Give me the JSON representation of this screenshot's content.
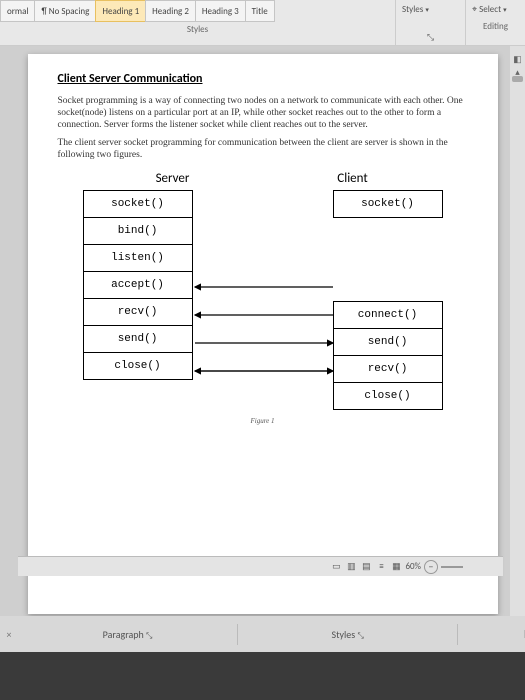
{
  "ribbon": {
    "styles": [
      "ormal",
      "¶ No Spacing",
      "Heading 1",
      "Heading 2",
      "Heading 3",
      "Title"
    ],
    "selected_index": 2,
    "styles_group_label": "Styles",
    "styles_dropdown": "Styles",
    "editing_group_label": "Editing",
    "select_label": "Select"
  },
  "document": {
    "title": "Client Server Communication",
    "para1": "Socket programming is a way of connecting two nodes on a network to communicate with each other. One socket(node) listens on a particular port at an IP, while other socket reaches out to the other to form a connection. Server forms the listener socket while client reaches out to the server.",
    "para2": "The client server socket programming for communication between the client are server is shown in the following two figures.",
    "server_header": "Server",
    "client_header": "Client",
    "server_boxes": [
      "socket()",
      "bind()",
      "listen()",
      "accept()",
      "recv()",
      "send()",
      "close()"
    ],
    "client_boxes": [
      "socket()",
      "connect()",
      "send()",
      "recv()",
      "close()"
    ],
    "figure_caption": "Figure 1"
  },
  "status": {
    "zoom": "60%",
    "paragraph_label": "Paragraph",
    "styles_label": "Styles"
  },
  "bottom": {
    "close": "×"
  }
}
